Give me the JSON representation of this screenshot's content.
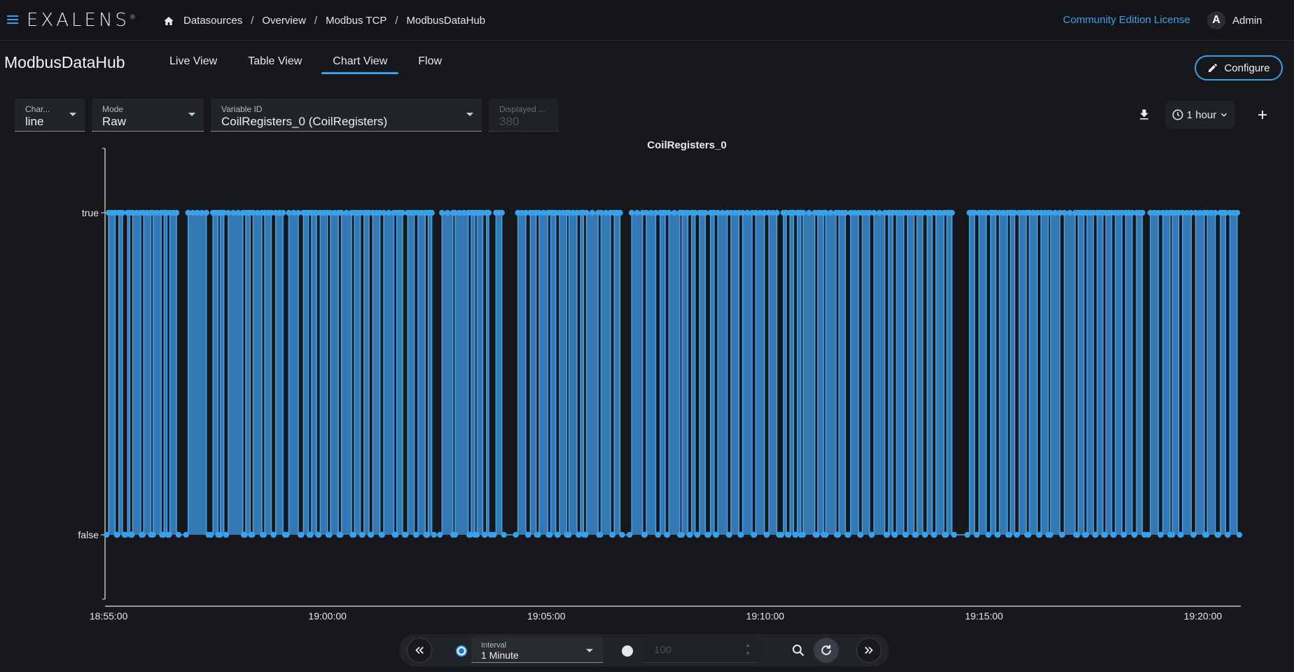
{
  "app": {
    "logo": "EXALENS",
    "breadcrumb": [
      "Datasources",
      "Overview",
      "Modbus TCP",
      "ModbusDataHub"
    ],
    "license_link": "Community Edition License",
    "user": {
      "initial": "A",
      "name": "Admin"
    }
  },
  "header": {
    "title": "ModbusDataHub",
    "tabs": [
      {
        "label": "Live View",
        "active": false
      },
      {
        "label": "Table View",
        "active": false
      },
      {
        "label": "Chart View",
        "active": true
      },
      {
        "label": "Flow",
        "active": false
      }
    ],
    "configure_label": "Configure"
  },
  "filters": {
    "chart_type": {
      "label": "Char...",
      "value": "line"
    },
    "mode": {
      "label": "Mode",
      "value": "Raw"
    },
    "variable": {
      "label": "Variable ID",
      "value": "CoilRegisters_0 (CoilRegisters)"
    },
    "displayed": {
      "label": "Displayed ...",
      "value": "380"
    },
    "time_range": "1 hour"
  },
  "chart_data": {
    "type": "line",
    "title": "CoilRegisters_0",
    "y_categories": [
      "false",
      "true"
    ],
    "x_ticks": [
      "18:55:00",
      "19:00:00",
      "19:05:00",
      "19:10:00",
      "19:15:00",
      "19:20:00"
    ],
    "x_range": [
      "18:54:57",
      "19:20:50"
    ],
    "series_color": "#3a8fd6",
    "point_count": 380,
    "true_segments": [
      [
        "18:55:00",
        "18:55:09"
      ],
      [
        "18:55:14",
        "18:55:19"
      ],
      [
        "18:55:26",
        "18:55:29"
      ],
      [
        "18:55:33",
        "18:55:44"
      ],
      [
        "18:55:48",
        "18:55:58"
      ],
      [
        "18:56:01",
        "18:56:12"
      ],
      [
        "18:56:16",
        "18:56:20"
      ],
      [
        "18:56:24",
        "18:56:33"
      ],
      [
        "18:56:49",
        "18:57:14"
      ],
      [
        "18:57:23",
        "18:57:30"
      ],
      [
        "18:57:33",
        "18:57:38"
      ],
      [
        "18:57:44",
        "18:58:04"
      ],
      [
        "18:58:08",
        "18:58:14"
      ],
      [
        "18:58:18",
        "18:58:30"
      ],
      [
        "18:58:34",
        "18:58:43"
      ],
      [
        "18:58:49",
        "18:58:59"
      ],
      [
        "18:59:07",
        "18:59:20"
      ],
      [
        "18:59:27",
        "18:59:34"
      ],
      [
        "18:59:38",
        "18:59:45"
      ],
      [
        "18:59:50",
        "19:00:00"
      ],
      [
        "19:00:04",
        "19:00:15"
      ],
      [
        "19:00:19",
        "19:00:33"
      ],
      [
        "19:00:37",
        "19:00:45"
      ],
      [
        "19:00:50",
        "19:00:57"
      ],
      [
        "19:01:02",
        "19:01:12"
      ],
      [
        "19:01:17",
        "19:01:31"
      ],
      [
        "19:01:35",
        "19:01:43"
      ],
      [
        "19:01:50",
        "19:01:59"
      ],
      [
        "19:02:04",
        "19:02:14"
      ],
      [
        "19:02:18",
        "19:02:23"
      ],
      [
        "19:02:37",
        "19:02:52"
      ],
      [
        "19:02:55",
        "19:03:13"
      ],
      [
        "19:03:17",
        "19:03:22"
      ],
      [
        "19:03:25",
        "19:03:33"
      ],
      [
        "19:03:38",
        "19:03:41"
      ],
      [
        "19:03:51",
        "19:03:59"
      ],
      [
        "19:04:21",
        "19:04:32"
      ],
      [
        "19:04:38",
        "19:04:46"
      ],
      [
        "19:04:50",
        "19:05:02"
      ],
      [
        "19:05:06",
        "19:05:13"
      ],
      [
        "19:05:18",
        "19:05:28"
      ],
      [
        "19:05:31",
        "19:05:42"
      ],
      [
        "19:05:47",
        "19:05:51"
      ],
      [
        "19:05:55",
        "19:06:11"
      ],
      [
        "19:06:15",
        "19:06:28"
      ],
      [
        "19:06:33",
        "19:06:41"
      ],
      [
        "19:06:57",
        "19:07:12"
      ],
      [
        "19:07:17",
        "19:07:30"
      ],
      [
        "19:07:36",
        "19:07:43"
      ],
      [
        "19:07:48",
        "19:08:03"
      ],
      [
        "19:08:06",
        "19:08:14"
      ],
      [
        "19:08:19",
        "19:08:24"
      ],
      [
        "19:08:30",
        "19:08:38"
      ],
      [
        "19:08:45",
        "19:08:50"
      ],
      [
        "19:08:55",
        "19:09:08"
      ],
      [
        "19:09:13",
        "19:09:24"
      ],
      [
        "19:09:29",
        "19:09:42"
      ],
      [
        "19:09:47",
        "19:09:59"
      ],
      [
        "19:10:05",
        "19:10:16"
      ],
      [
        "19:10:25",
        "19:10:29"
      ],
      [
        "19:10:34",
        "19:10:39"
      ],
      [
        "19:10:44",
        "19:10:49"
      ],
      [
        "19:10:52",
        "19:11:08"
      ],
      [
        "19:11:12",
        "19:11:20"
      ],
      [
        "19:11:23",
        "19:11:37"
      ],
      [
        "19:11:41",
        "19:11:50"
      ],
      [
        "19:11:57",
        "19:12:08"
      ],
      [
        "19:12:13",
        "19:12:23"
      ],
      [
        "19:12:29",
        "19:12:44"
      ],
      [
        "19:12:49",
        "19:12:55"
      ],
      [
        "19:13:00",
        "19:13:10"
      ],
      [
        "19:13:15",
        "19:13:24"
      ],
      [
        "19:13:28",
        "19:13:36"
      ],
      [
        "19:13:42",
        "19:13:49"
      ],
      [
        "19:13:54",
        "19:14:05"
      ],
      [
        "19:14:09",
        "19:14:16"
      ],
      [
        "19:14:40",
        "19:14:47"
      ],
      [
        "19:14:53",
        "19:15:03"
      ],
      [
        "19:15:09",
        "19:15:16"
      ],
      [
        "19:15:21",
        "19:15:32"
      ],
      [
        "19:15:36",
        "19:15:42"
      ],
      [
        "19:15:48",
        "19:15:58"
      ],
      [
        "19:16:02",
        "19:16:13"
      ],
      [
        "19:16:18",
        "19:16:28"
      ],
      [
        "19:16:31",
        "19:16:44"
      ],
      [
        "19:16:50",
        "19:17:05"
      ],
      [
        "19:17:09",
        "19:17:17"
      ],
      [
        "19:17:21",
        "19:17:30"
      ],
      [
        "19:17:35",
        "19:17:43"
      ],
      [
        "19:17:47",
        "19:17:55"
      ],
      [
        "19:18:00",
        "19:18:09"
      ],
      [
        "19:18:14",
        "19:18:23"
      ],
      [
        "19:18:29",
        "19:18:37"
      ],
      [
        "19:18:48",
        "19:18:59"
      ],
      [
        "19:19:05",
        "19:19:15"
      ],
      [
        "19:19:18",
        "19:19:27"
      ],
      [
        "19:19:32",
        "19:19:44"
      ],
      [
        "19:19:50",
        "19:20:02"
      ],
      [
        "19:20:06",
        "19:20:17"
      ],
      [
        "19:20:24",
        "19:20:31"
      ],
      [
        "19:20:37",
        "19:20:47"
      ]
    ]
  },
  "bottom": {
    "interval_label": "Interval",
    "interval_value": "1 Minute",
    "count_value": "100"
  }
}
